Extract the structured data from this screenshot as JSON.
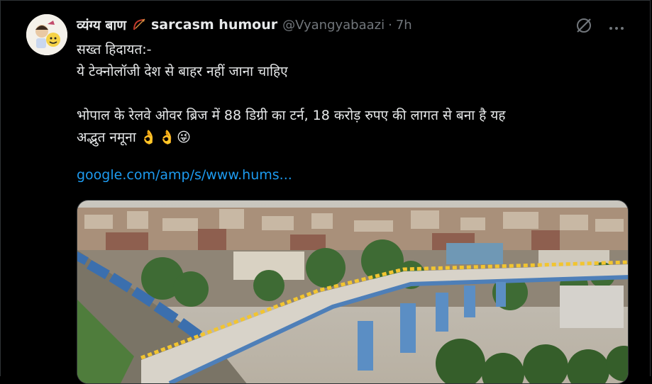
{
  "post": {
    "display_name": "व्यंग्य बाण",
    "badge_icon": "bow-arrow-icon",
    "secondary_name": "sarcasm humour",
    "handle": "@Vyangyabaazi",
    "separator": "·",
    "time": "7h",
    "lines": [
      "सख्त हिदायत:-",
      "ये टेक्नोलॉजी देश से बाहर नहीं जाना चाहिए",
      "भोपाल के रेलवे ओवर ब्रिज में 88 डिग्री का टर्न, 18 करोड़ रुपए की लागत से बना है यह",
      "अद्भुत नमूना"
    ],
    "emojis": "👌👌😜",
    "link_text": "google.com/amp/s/www.hums..."
  },
  "icons": {
    "grok": "grok-icon",
    "more": "more-icon"
  },
  "colors": {
    "background": "#000000",
    "text": "#e7e9ea",
    "muted": "#71767b",
    "link": "#1d9bf0"
  }
}
